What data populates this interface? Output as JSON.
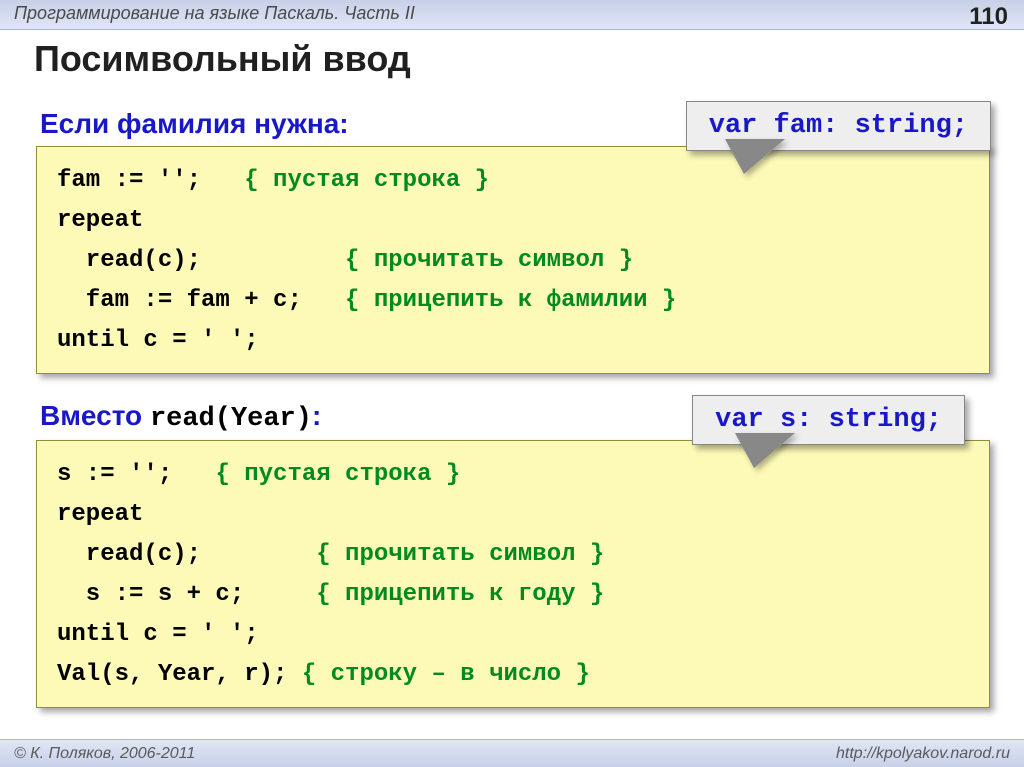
{
  "header": {
    "title": "Программирование на языке Паскаль. Часть II",
    "page_no": "110"
  },
  "slide_title": "Посимвольный ввод",
  "section1": {
    "heading": "Если фамилия нужна:",
    "callout": "var fam: string;",
    "code": {
      "l1a": "fam := '';   ",
      "l1c": "{ пустая строка }",
      "l2": "repeat",
      "l3a": "  read(c);          ",
      "l3c": "{ прочитать символ }",
      "l4a": "  fam := fam + c;   ",
      "l4c": "{ прицепить к фамилии }",
      "l5": "until c = ' ';"
    }
  },
  "section2": {
    "heading_pre": "Вместо ",
    "heading_code": "read(Year)",
    "heading_post": ":",
    "callout": "var s: string;",
    "code": {
      "l1a": "s := '';   ",
      "l1c": "{ пустая строка }",
      "l2": "repeat",
      "l3a": "  read(c);        ",
      "l3c": "{ прочитать символ }",
      "l4a": "  s := s + c;     ",
      "l4c": "{ прицепить к году }",
      "l5": "until c = ' ';",
      "l6a": "Val(s, Year, r); ",
      "l6c": "{ строку – в число }"
    }
  },
  "footer": {
    "left": "© К. Поляков, 2006-2011",
    "right": "http://kpolyakov.narod.ru"
  }
}
